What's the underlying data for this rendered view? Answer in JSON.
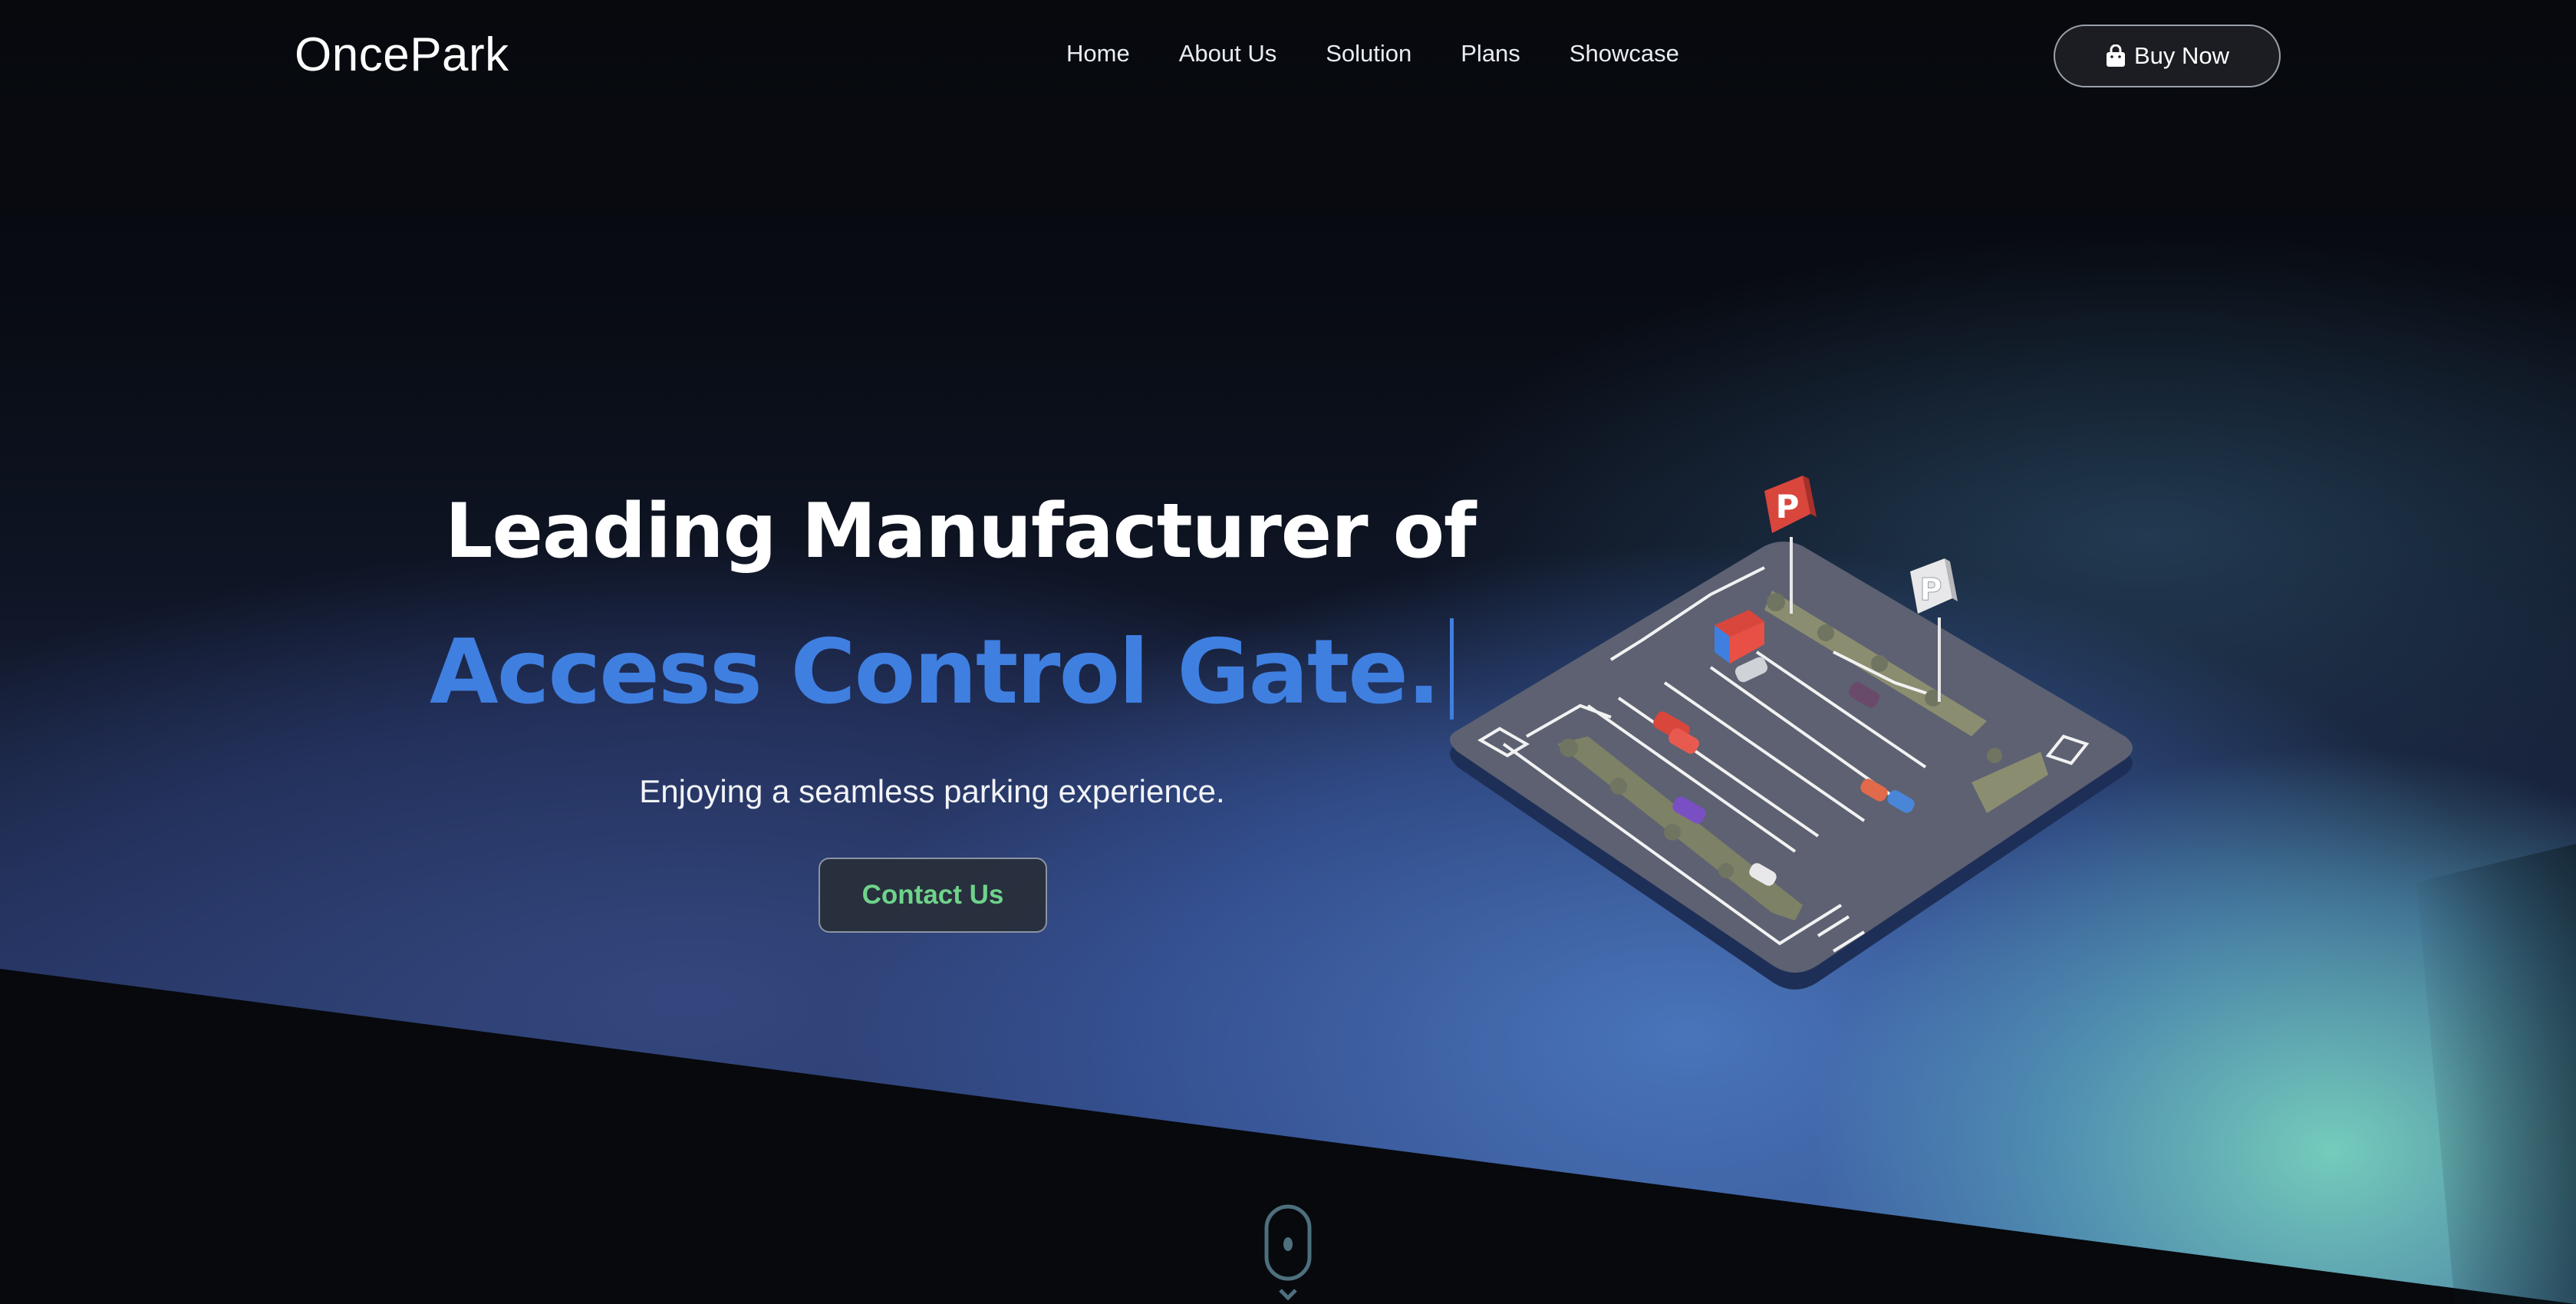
{
  "header": {
    "logo": "OncePark",
    "nav": [
      "Home",
      "About Us",
      "Solution",
      "Plans",
      "Showcase"
    ],
    "buy_button": {
      "label": "Buy Now",
      "icon": "shopping-bag-icon"
    }
  },
  "hero": {
    "title_line1": "Leading Manufacturer of",
    "title_line2": "Access Control Gate.",
    "subtitle": "Enjoying a seamless parking experience.",
    "contact_button": "Contact Us",
    "illustration_signs": [
      "P",
      "P"
    ]
  },
  "scroll_indicator": {
    "icon": "mouse-scroll-icon"
  },
  "colors": {
    "background": "#07090d",
    "accent_blue": "#3f7fe0",
    "contact_green": "#6fd38a",
    "sign_red": "#d9463c",
    "sign_white": "#e8e8ea"
  }
}
